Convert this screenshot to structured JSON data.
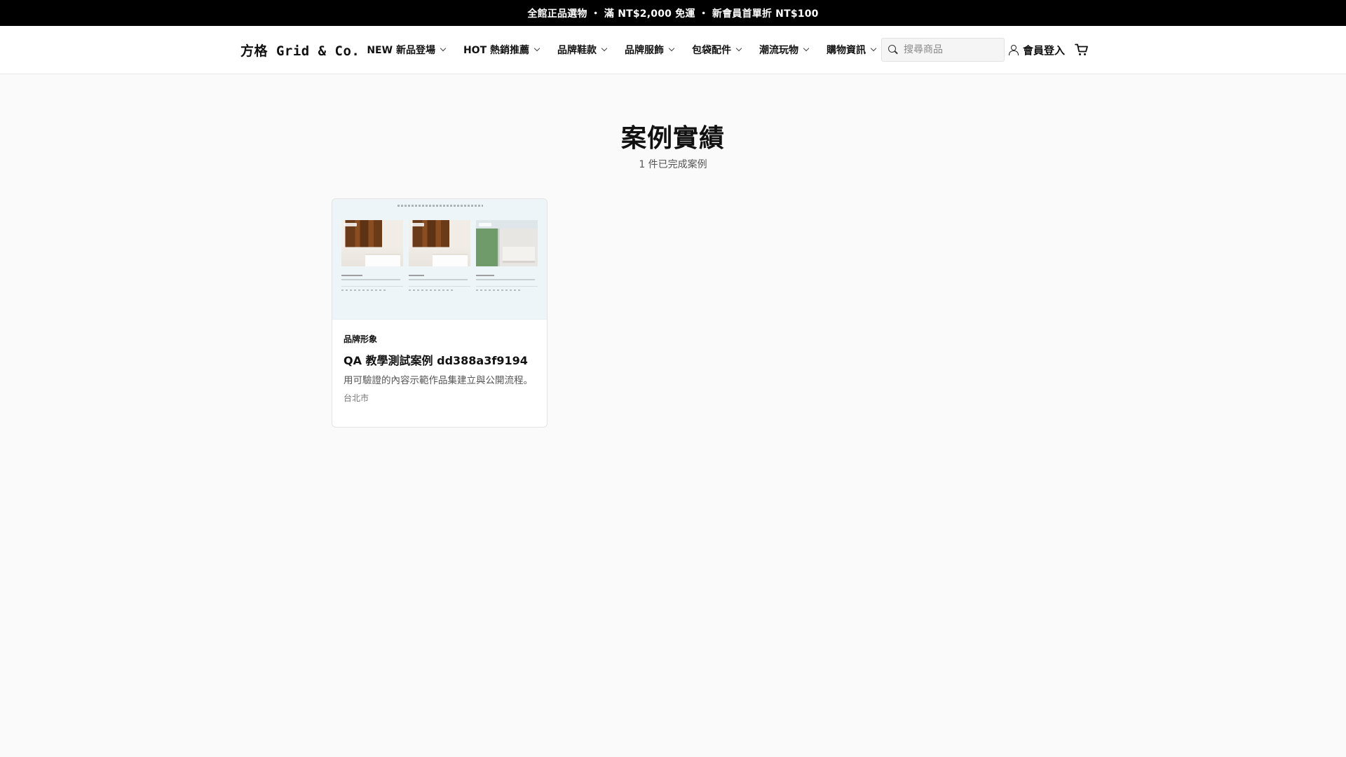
{
  "announcement": {
    "text": "全館正品選物 ・ 滿 NT$2,000 免運 ・ 新會員首單折 NT$100"
  },
  "header": {
    "logo": "方格 Grid & Co.",
    "nav": [
      {
        "label": "NEW 新品登場"
      },
      {
        "label": "HOT 熱銷推薦"
      },
      {
        "label": "品牌鞋款"
      },
      {
        "label": "品牌服飾"
      },
      {
        "label": "包袋配件"
      },
      {
        "label": "潮流玩物"
      },
      {
        "label": "購物資訊"
      }
    ],
    "search": {
      "placeholder": "搜尋商品",
      "icon": "search-icon"
    },
    "login_label": "會員登入",
    "login_icon": "user-icon",
    "cart_icon": "cart-icon"
  },
  "main": {
    "title": "案例實績",
    "subtitle": "1 件已完成案例",
    "cases": [
      {
        "category": "品牌形象",
        "title": "QA 教學測試案例 dd388a3f9194",
        "description": "用可驗證的內容示範作品集建立與公開流程。",
        "location": "台北市"
      }
    ]
  }
}
